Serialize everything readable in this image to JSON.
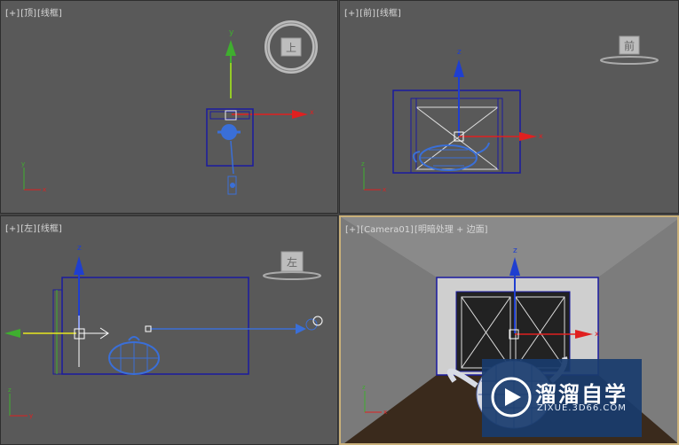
{
  "viewports": {
    "top": {
      "plus": "[+]",
      "view": "[顶]",
      "mode": "[线框]",
      "cube_label": "上"
    },
    "front": {
      "plus": "[+]",
      "view": "[前]",
      "mode": "[线框]",
      "cube_label": "前"
    },
    "left": {
      "plus": "[+]",
      "view": "[左]",
      "mode": "[线框]",
      "cube_label": "左"
    },
    "camera": {
      "plus": "[+]",
      "view": "[Camera01]",
      "mode": "[明暗处理 + 边面]"
    }
  },
  "axes": {
    "x": "x",
    "y": "y",
    "z": "z"
  },
  "colors": {
    "x_axis": "#e02020",
    "y_axis": "#3fae2f",
    "z_axis": "#1f3fd0",
    "wire": "#1a1aa0",
    "teapot": "#3a6fd8",
    "active_border": "#c9b07a"
  },
  "watermark": {
    "title": "溜溜自学",
    "url": "ZIXUE.3D66.COM",
    "icon": "play-logo-icon"
  }
}
